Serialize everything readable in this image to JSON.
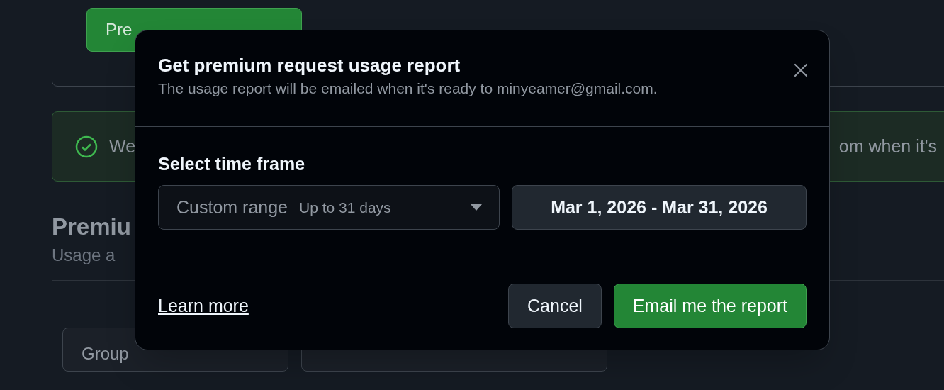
{
  "background": {
    "primary_button": "Pre",
    "alert": {
      "text_start": "We",
      "text_end": "om when it's"
    },
    "section_title": "Premiu",
    "section_subtitle": "Usage a",
    "filters": [
      "Group"
    ]
  },
  "dialog": {
    "title": "Get premium request usage report",
    "subtitle": "The usage report will be emailed when it's ready to minyeamer@gmail.com.",
    "section_label": "Select time frame",
    "range_select": {
      "value": "Custom range",
      "hint": "Up to 31 days"
    },
    "date_range": "Mar 1, 2026 - Mar 31, 2026",
    "link": "Learn more",
    "buttons": [
      {
        "label": "Cancel",
        "kind": "secondary"
      },
      {
        "label": "Email me the report",
        "kind": "primary"
      }
    ]
  }
}
